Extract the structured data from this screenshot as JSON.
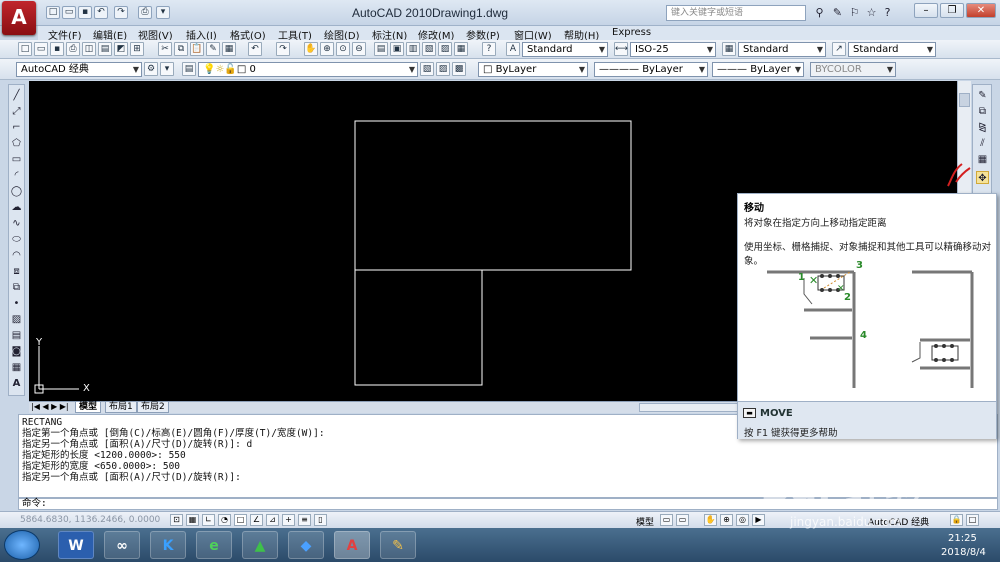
{
  "app": {
    "logo": "A",
    "title": "AutoCAD 2010",
    "document": "Drawing1.dwg",
    "search_placeholder": "键入关键字或短语"
  },
  "menu": [
    "文件(F)",
    "编辑(E)",
    "视图(V)",
    "插入(I)",
    "格式(O)",
    "工具(T)",
    "绘图(D)",
    "标注(N)",
    "修改(M)",
    "参数(P)",
    "窗口(W)",
    "帮助(H)",
    "Express"
  ],
  "styles": {
    "text_style": "Standard",
    "dim_style": "ISO-25",
    "table_style": "Standard",
    "multileader_style": "Standard"
  },
  "properties": {
    "workspace": "AutoCAD 经典",
    "layer": "0",
    "color": "ByLayer",
    "linetype": "ByLayer",
    "lineweight": "ByLayer",
    "plotstyle": "BYCOLOR"
  },
  "canvas": {
    "ucs_y": "Y",
    "ucs_x": "X"
  },
  "layout_tabs": [
    "模型",
    "布局1",
    "布局2"
  ],
  "command_history": [
    "RECTANG",
    "指定第一个角点或 [倒角(C)/标高(E)/圆角(F)/厚度(T)/宽度(W)]:",
    "指定另一个角点或 [面积(A)/尺寸(D)/旋转(R)]: d",
    "指定矩形的长度 <1200.0000>: 550",
    "指定矩形的宽度 <650.0000>: 500",
    "指定另一个角点或 [面积(A)/尺寸(D)/旋转(R)]:"
  ],
  "command_prompt": "命令:",
  "status": {
    "coords": "5864.6830, 1136.2466, 0.0000",
    "model_label": "模型",
    "workspace_label": "AutoCAD 经典"
  },
  "tooltip": {
    "title": "移动",
    "description": "将对象在指定方向上移动指定距离",
    "detail": "使用坐标、栅格捕捉、对象捕捉和其他工具可以精确移动对象。",
    "command": "MOVE",
    "help": "按 F1 键获得更多帮助",
    "step_labels": [
      "1",
      "2",
      "3",
      "4"
    ]
  },
  "taskbar": {
    "time": "21:25",
    "date": "2018/8/4"
  },
  "watermark": {
    "text": "Bai 经验",
    "url": "jingyan.baidu.com"
  }
}
